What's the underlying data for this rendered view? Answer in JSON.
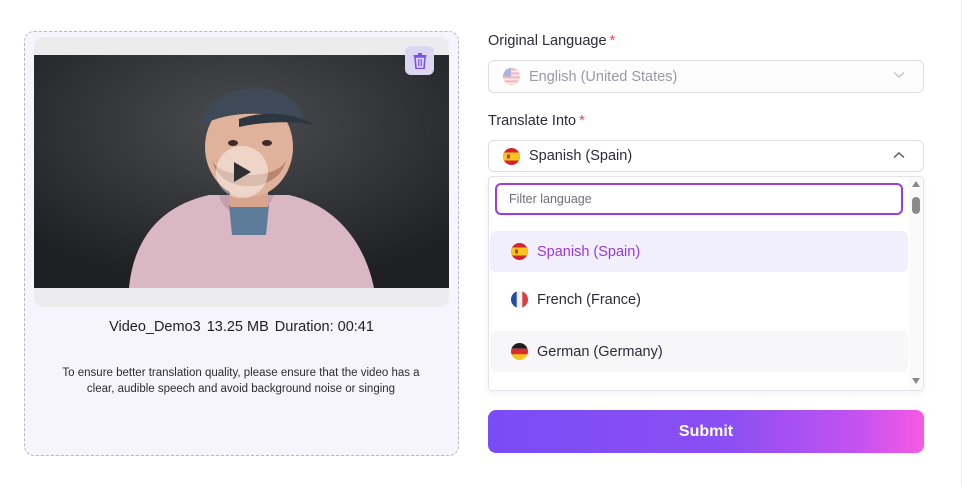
{
  "video": {
    "file_name": "Video_Demo3",
    "file_size": "13.25 MB",
    "duration": "Duration: 00:41",
    "hint": "To ensure better translation quality, please ensure that the video has a clear, audible speech and avoid background noise or singing"
  },
  "original_language": {
    "label": "Original Language",
    "required_mark": "*",
    "value": "English (United States)",
    "flag_icon": "us-flag-icon"
  },
  "translate_into": {
    "label": "Translate Into",
    "required_mark": "*",
    "value": "Spanish (Spain)",
    "flag_icon": "spain-flag-icon",
    "filter_placeholder": "Filter language",
    "options": [
      {
        "label": "Spanish (Spain)",
        "flag_icon": "spain-flag-icon",
        "selected": true
      },
      {
        "label": "French (France)",
        "flag_icon": "france-flag-icon",
        "selected": false
      },
      {
        "label": "German (Germany)",
        "flag_icon": "germany-flag-icon",
        "selected": false
      }
    ]
  },
  "submit_label": "Submit",
  "colors": {
    "accent": "#9a39d6",
    "panel_bg": "#f6f4fd",
    "required": "#e54848",
    "button_gradient_start": "#7a4cf6",
    "button_gradient_end": "#f65ae4"
  }
}
